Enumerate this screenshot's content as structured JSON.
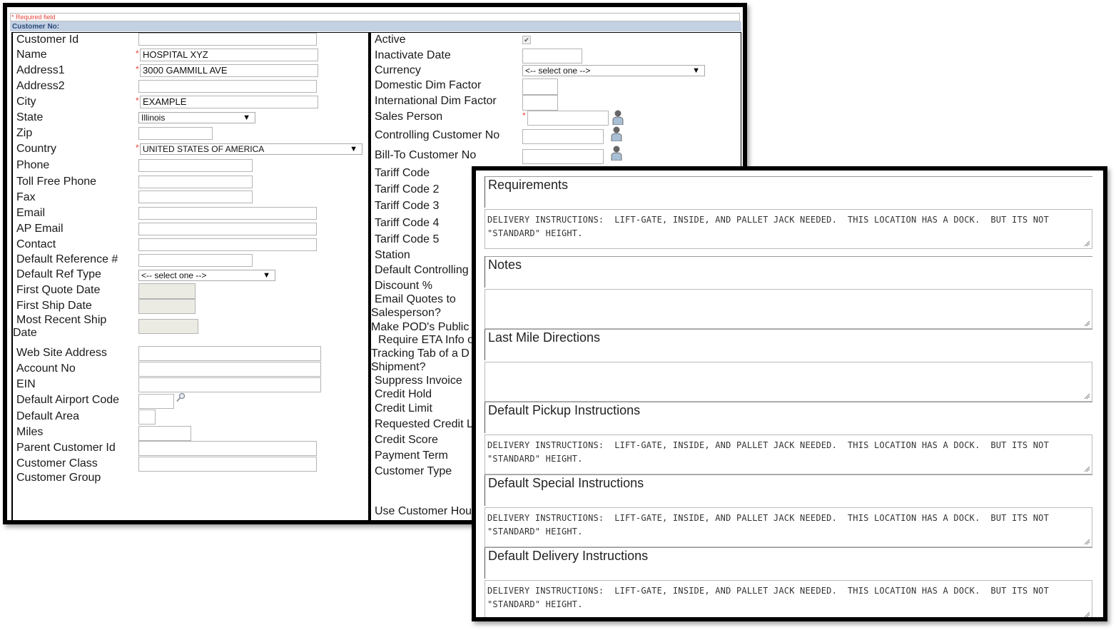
{
  "form": {
    "required_note": "* Required field",
    "customer_no_label": "Customer No:",
    "required_marker": "*",
    "left": {
      "customer_id": {
        "label": "Customer Id",
        "value": ""
      },
      "name": {
        "label": "Name",
        "value": "HOSPITAL XYZ",
        "required": true
      },
      "address1": {
        "label": "Address1",
        "value": "3000 GAMMILL AVE",
        "required": true
      },
      "address2": {
        "label": "Address2",
        "value": ""
      },
      "city": {
        "label": "City",
        "value": "EXAMPLE",
        "required": true
      },
      "state": {
        "label": "State",
        "value": "Illinois"
      },
      "zip": {
        "label": "Zip",
        "value": ""
      },
      "country": {
        "label": "Country",
        "value": "UNITED STATES OF AMERICA",
        "required": true
      },
      "phone": {
        "label": "Phone",
        "value": ""
      },
      "toll_free_phone": {
        "label": "Toll Free Phone",
        "value": ""
      },
      "fax": {
        "label": "Fax",
        "value": ""
      },
      "email": {
        "label": "Email",
        "value": ""
      },
      "ap_email": {
        "label": "AP Email",
        "value": ""
      },
      "contact": {
        "label": "Contact",
        "value": ""
      },
      "default_reference": {
        "label": "Default Reference #",
        "value": ""
      },
      "default_ref_type": {
        "label": "Default Ref Type",
        "value": "<-- select one -->"
      },
      "first_quote_date": {
        "label": "First Quote Date",
        "value": ""
      },
      "first_ship_date": {
        "label": "First Ship Date",
        "value": ""
      },
      "most_recent_ship_date": {
        "label_line1": "Most Recent Ship",
        "label_line2": "Date",
        "value": ""
      },
      "web_site_address": {
        "label": "Web Site Address",
        "value": ""
      },
      "account_no": {
        "label": "Account No",
        "value": ""
      },
      "ein": {
        "label": "EIN",
        "value": ""
      },
      "default_airport_code": {
        "label": "Default Airport Code",
        "value": ""
      },
      "default_area": {
        "label": "Default Area",
        "value": ""
      },
      "miles": {
        "label": "Miles",
        "value": ""
      },
      "parent_customer_id": {
        "label": "Parent Customer Id",
        "value": ""
      },
      "customer_class": {
        "label": "Customer Class",
        "value": ""
      },
      "customer_group": {
        "label": "Customer Group"
      }
    },
    "right": {
      "active": {
        "label": "Active",
        "checked": true,
        "check_glyph": "✔"
      },
      "inactivate_date": {
        "label": "Inactivate Date",
        "value": ""
      },
      "currency": {
        "label": "Currency",
        "value": "<-- select one -->"
      },
      "domestic_dim_factor": {
        "label": "Domestic Dim Factor",
        "value": ""
      },
      "international_dim_factor": {
        "label": "International Dim Factor",
        "value": ""
      },
      "sales_person": {
        "label": "Sales Person",
        "value": "",
        "required": true
      },
      "controlling_customer_no": {
        "label": "Controlling Customer No",
        "value": ""
      },
      "bill_to_customer_no": {
        "label": "Bill-To Customer No",
        "value": ""
      },
      "tariff_code": {
        "label": "Tariff Code"
      },
      "tariff_code_2": {
        "label": "Tariff Code 2"
      },
      "tariff_code_3": {
        "label": "Tariff Code 3"
      },
      "tariff_code_4": {
        "label": "Tariff Code 4"
      },
      "tariff_code_5": {
        "label": "Tariff Code 5"
      },
      "station": {
        "label": "Station"
      },
      "default_controlling": {
        "label": "Default Controlling"
      },
      "discount": {
        "label": "Discount %"
      },
      "email_quotes": {
        "label_line1": "Email Quotes to",
        "label_line2": "Salesperson?"
      },
      "make_pods_public": {
        "label": "Make POD's Public"
      },
      "require_eta": {
        "label_line1": "Require ETA Info o",
        "label_line2": "Tracking Tab of a D",
        "label_line3": "Shipment?"
      },
      "suppress_invoice": {
        "label": "Suppress Invoice"
      },
      "credit_hold": {
        "label": "Credit Hold"
      },
      "credit_limit": {
        "label": "Credit Limit"
      },
      "requested_credit": {
        "label": "Requested Credit L"
      },
      "credit_score": {
        "label": "Credit Score"
      },
      "payment_term": {
        "label": "Payment Term"
      },
      "customer_type": {
        "label": "Customer Type"
      },
      "use_customer_hours": {
        "label": "Use Customer Hou"
      }
    },
    "dropdown_arrow": "▼"
  },
  "instructions": {
    "sections": [
      {
        "title": "Requirements",
        "value": "DELIVERY INSTRUCTIONS:  LIFT-GATE, INSIDE, AND PALLET JACK NEEDED.  THIS LOCATION HAS A DOCK.  BUT ITS NOT\n\"STANDARD\" HEIGHT."
      },
      {
        "title": "Notes",
        "value": ""
      },
      {
        "title": "Last Mile Directions",
        "value": ""
      },
      {
        "title": "Default Pickup Instructions",
        "value": "DELIVERY INSTRUCTIONS:  LIFT-GATE, INSIDE, AND PALLET JACK NEEDED.  THIS LOCATION HAS A DOCK.  BUT ITS NOT\n\"STANDARD\" HEIGHT."
      },
      {
        "title": "Default Special Instructions",
        "value": "DELIVERY INSTRUCTIONS:  LIFT-GATE, INSIDE, AND PALLET JACK NEEDED.  THIS LOCATION HAS A DOCK.  BUT ITS NOT\n\"STANDARD\" HEIGHT."
      },
      {
        "title": "Default Delivery Instructions",
        "value": "DELIVERY INSTRUCTIONS:  LIFT-GATE, INSIDE, AND PALLET JACK NEEDED.  THIS LOCATION HAS A DOCK.  BUT ITS NOT\n\"STANDARD\" HEIGHT."
      }
    ]
  },
  "colors": {
    "required": "#e8443c",
    "header_bar": "#c3d1e3",
    "disabled_input": "#ebebe4"
  }
}
